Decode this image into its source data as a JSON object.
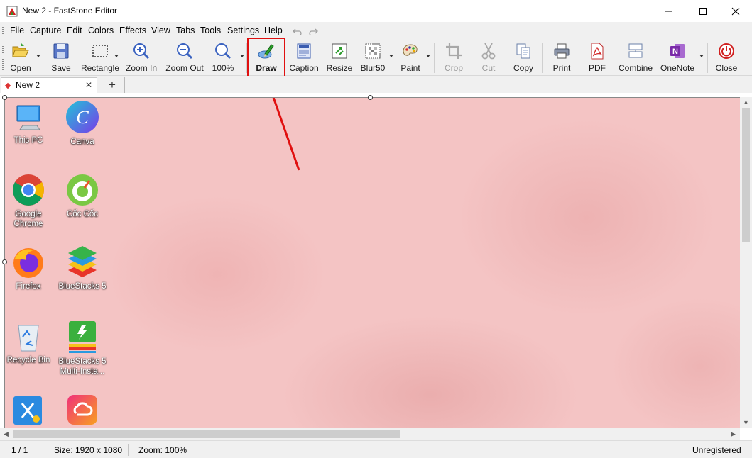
{
  "window": {
    "title": "New 2 - FastStone Editor"
  },
  "menu": [
    "File",
    "Capture",
    "Edit",
    "Colors",
    "Effects",
    "View",
    "Tabs",
    "Tools",
    "Settings",
    "Help"
  ],
  "toolbar": {
    "open": "Open",
    "save": "Save",
    "rectangle": "Rectangle",
    "zoom_in": "Zoom In",
    "zoom_out": "Zoom Out",
    "zoom_level": "100%",
    "draw": "Draw",
    "caption": "Caption",
    "resize": "Resize",
    "blur": "Blur50",
    "paint": "Paint",
    "crop": "Crop",
    "cut": "Cut",
    "copy": "Copy",
    "print": "Print",
    "pdf": "PDF",
    "combine": "Combine",
    "onenote": "OneNote",
    "close": "Close"
  },
  "tabs": {
    "active": "New 2",
    "close_glyph": "✕",
    "add_glyph": "+"
  },
  "desktop_icons": [
    "This PC",
    "Canva",
    "Google Chrome",
    "Cốc Cốc",
    "Firefox",
    "BlueStacks 5",
    "Recycle Bin",
    "BlueStacks 5 Multi-Insta..."
  ],
  "status": {
    "page": "1 / 1",
    "size": "Size: 1920 x 1080",
    "zoom": "Zoom: 100%",
    "registration": "Unregistered"
  },
  "colors": {
    "highlight": "#e01010",
    "canvas_bg": "#f4c4c4",
    "chrome_bg": "#f0f0f0"
  }
}
